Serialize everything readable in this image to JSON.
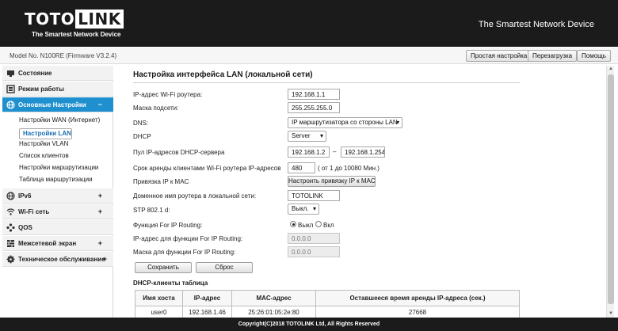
{
  "header": {
    "logo_left": "TOTO",
    "logo_right": "LINK",
    "logo_sub": "The Smartest Network Device",
    "tagline": "The Smartest Network Device"
  },
  "modelbar": {
    "model": "Model No. N100RE (Firmware V3.2.4)",
    "buttons": [
      "Простая настройка",
      "Перезагрузка",
      "Помощь"
    ]
  },
  "sidebar": {
    "items": [
      {
        "label": "Состояние",
        "icon": "monitor-icon",
        "sign": ""
      },
      {
        "label": "Режим работы",
        "icon": "mode-icon",
        "sign": ""
      },
      {
        "label": "Основные Настройки",
        "icon": "globe-icon",
        "sign": "−"
      },
      {
        "label": "IPv6",
        "icon": "globe-icon",
        "sign": "+"
      },
      {
        "label": "Wi-Fi сеть",
        "icon": "wifi-icon",
        "sign": "+"
      },
      {
        "label": "QOS",
        "icon": "qos-icon",
        "sign": ""
      },
      {
        "label": "Межсетевой экран",
        "icon": "firewall-icon",
        "sign": "+"
      },
      {
        "label": "Техническое обслуживание",
        "icon": "gear-icon",
        "sign": "+"
      }
    ],
    "subitems": [
      "Настройки WAN (Интернет)",
      "Настройки LAN",
      "Настройки VLAN",
      "Список клиентов",
      "Настройки маршрутизации",
      "Таблица маршрутизации"
    ]
  },
  "main": {
    "title": "Настройка интерфейса LAN (локальной сети)",
    "fields": {
      "ip_label": "IP-адрес Wi-Fi роутера:",
      "ip_value": "192.168.1.1",
      "mask_label": "Маска подсети:",
      "mask_value": "255.255.255.0",
      "dns_label": "DNS:",
      "dns_value": "IP маршрутизатора со стороны LAN",
      "dhcp_label": "DHCP",
      "dhcp_value": "Server",
      "pool_label": "Пул IP-адресов DHCP-сервера",
      "pool_start": "192.168.1.2",
      "pool_sep": "–",
      "pool_end": "192.168.1.254",
      "lease_label": "Срок аренды клиентами Wi-Fi роутера IP-адресов",
      "lease_value": "480",
      "lease_hint": "( от 1 до 10080 Мин.)",
      "bind_label": "Привязка IP к MAC",
      "bind_button": "Настроить привязку IP к MAC",
      "domain_label": "Доменное имя роутера в локальной сети:",
      "domain_value": "TOTOLINK",
      "stp_label": "STP 802.1 d:",
      "stp_value": "Выкл.",
      "iprouting_label": "Функция For IP Routing:",
      "iprouting_off": "Выкл",
      "iprouting_on": "Вкл",
      "rip_ip_label": "IP-адрес для функции For IP Routing:",
      "rip_ip_placeholder": "0.0.0.0",
      "rip_mask_label": "Маска для функции For IP Routing:",
      "rip_mask_placeholder": "0.0.0.0"
    },
    "save_button": "Сохранить",
    "reset_button": "Сброс",
    "table": {
      "title": "DHCP-клиенты таблица",
      "columns": [
        "Имя хоста",
        "IP-адрес",
        "MAC-адрес",
        "Оставшееся время аренды IP-адреса (сек.)"
      ],
      "rows": [
        [
          "user0",
          "192.168.1.46",
          "25:26:01:05:2e:80",
          "27668"
        ]
      ]
    }
  },
  "footer": {
    "text": "Copyright(C)2018 TOTOLINK Ltd, All Rights Reserved"
  },
  "colors": {
    "topbar": "#1b1b1b",
    "accent": "#1e8fcf"
  }
}
